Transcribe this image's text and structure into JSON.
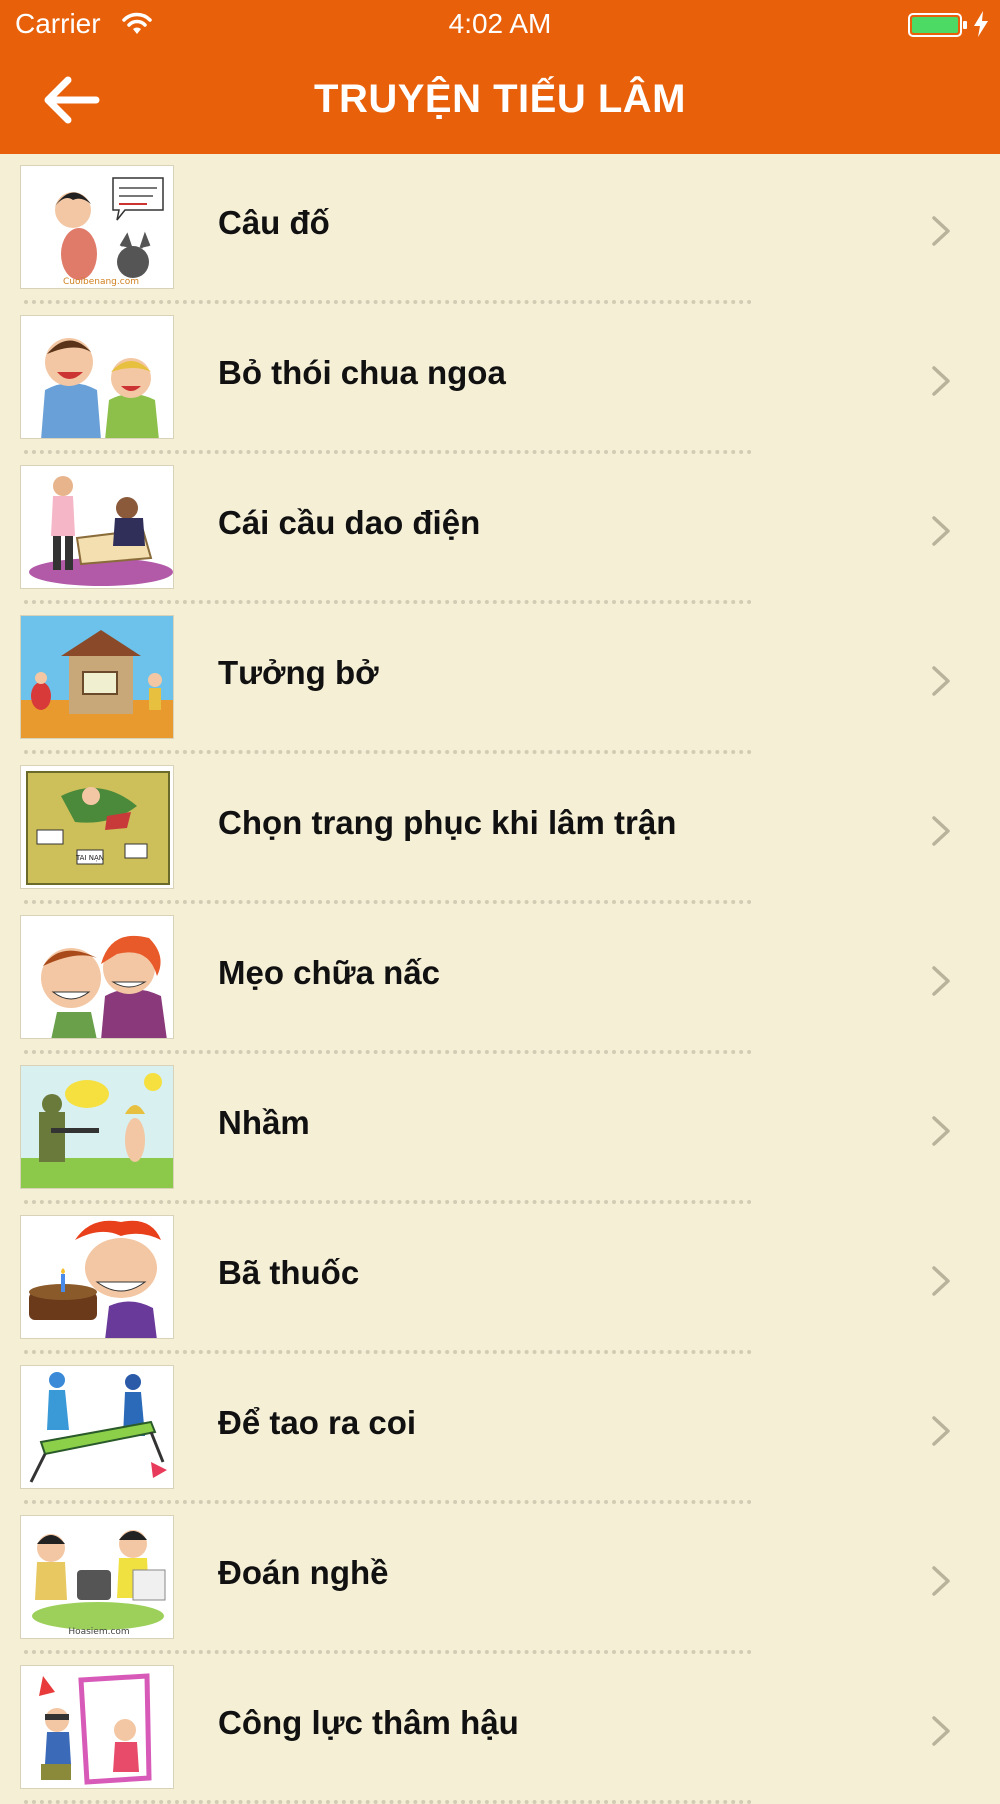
{
  "status_bar": {
    "carrier": "Carrier",
    "time": "4:02 AM"
  },
  "header": {
    "title": "TRUYỆN TIẾU LÂM"
  },
  "stories": [
    {
      "title": "Câu đố",
      "image_tag": "Cuoibenang.com"
    },
    {
      "title": "Bỏ thói chua ngoa",
      "image_tag": ""
    },
    {
      "title": "Cái cầu dao điện",
      "image_tag": ""
    },
    {
      "title": "Tưởng bở",
      "image_tag": ""
    },
    {
      "title": "Chọn trang phục khi lâm trận",
      "image_tag": "TAI NẠN"
    },
    {
      "title": "Mẹo chữa nấc",
      "image_tag": ""
    },
    {
      "title": "Nhầm",
      "image_tag": ""
    },
    {
      "title": "Bã thuốc",
      "image_tag": ""
    },
    {
      "title": "Để tao ra coi",
      "image_tag": ""
    },
    {
      "title": "Đoán nghề",
      "image_tag": "Hoasiem.com"
    },
    {
      "title": "Công lực thâm hậu",
      "image_tag": ""
    }
  ],
  "colors": {
    "header": "#e8600a",
    "background": "#f5efd6",
    "divider": "#d2ccb4",
    "chevron": "#b9b39c"
  }
}
